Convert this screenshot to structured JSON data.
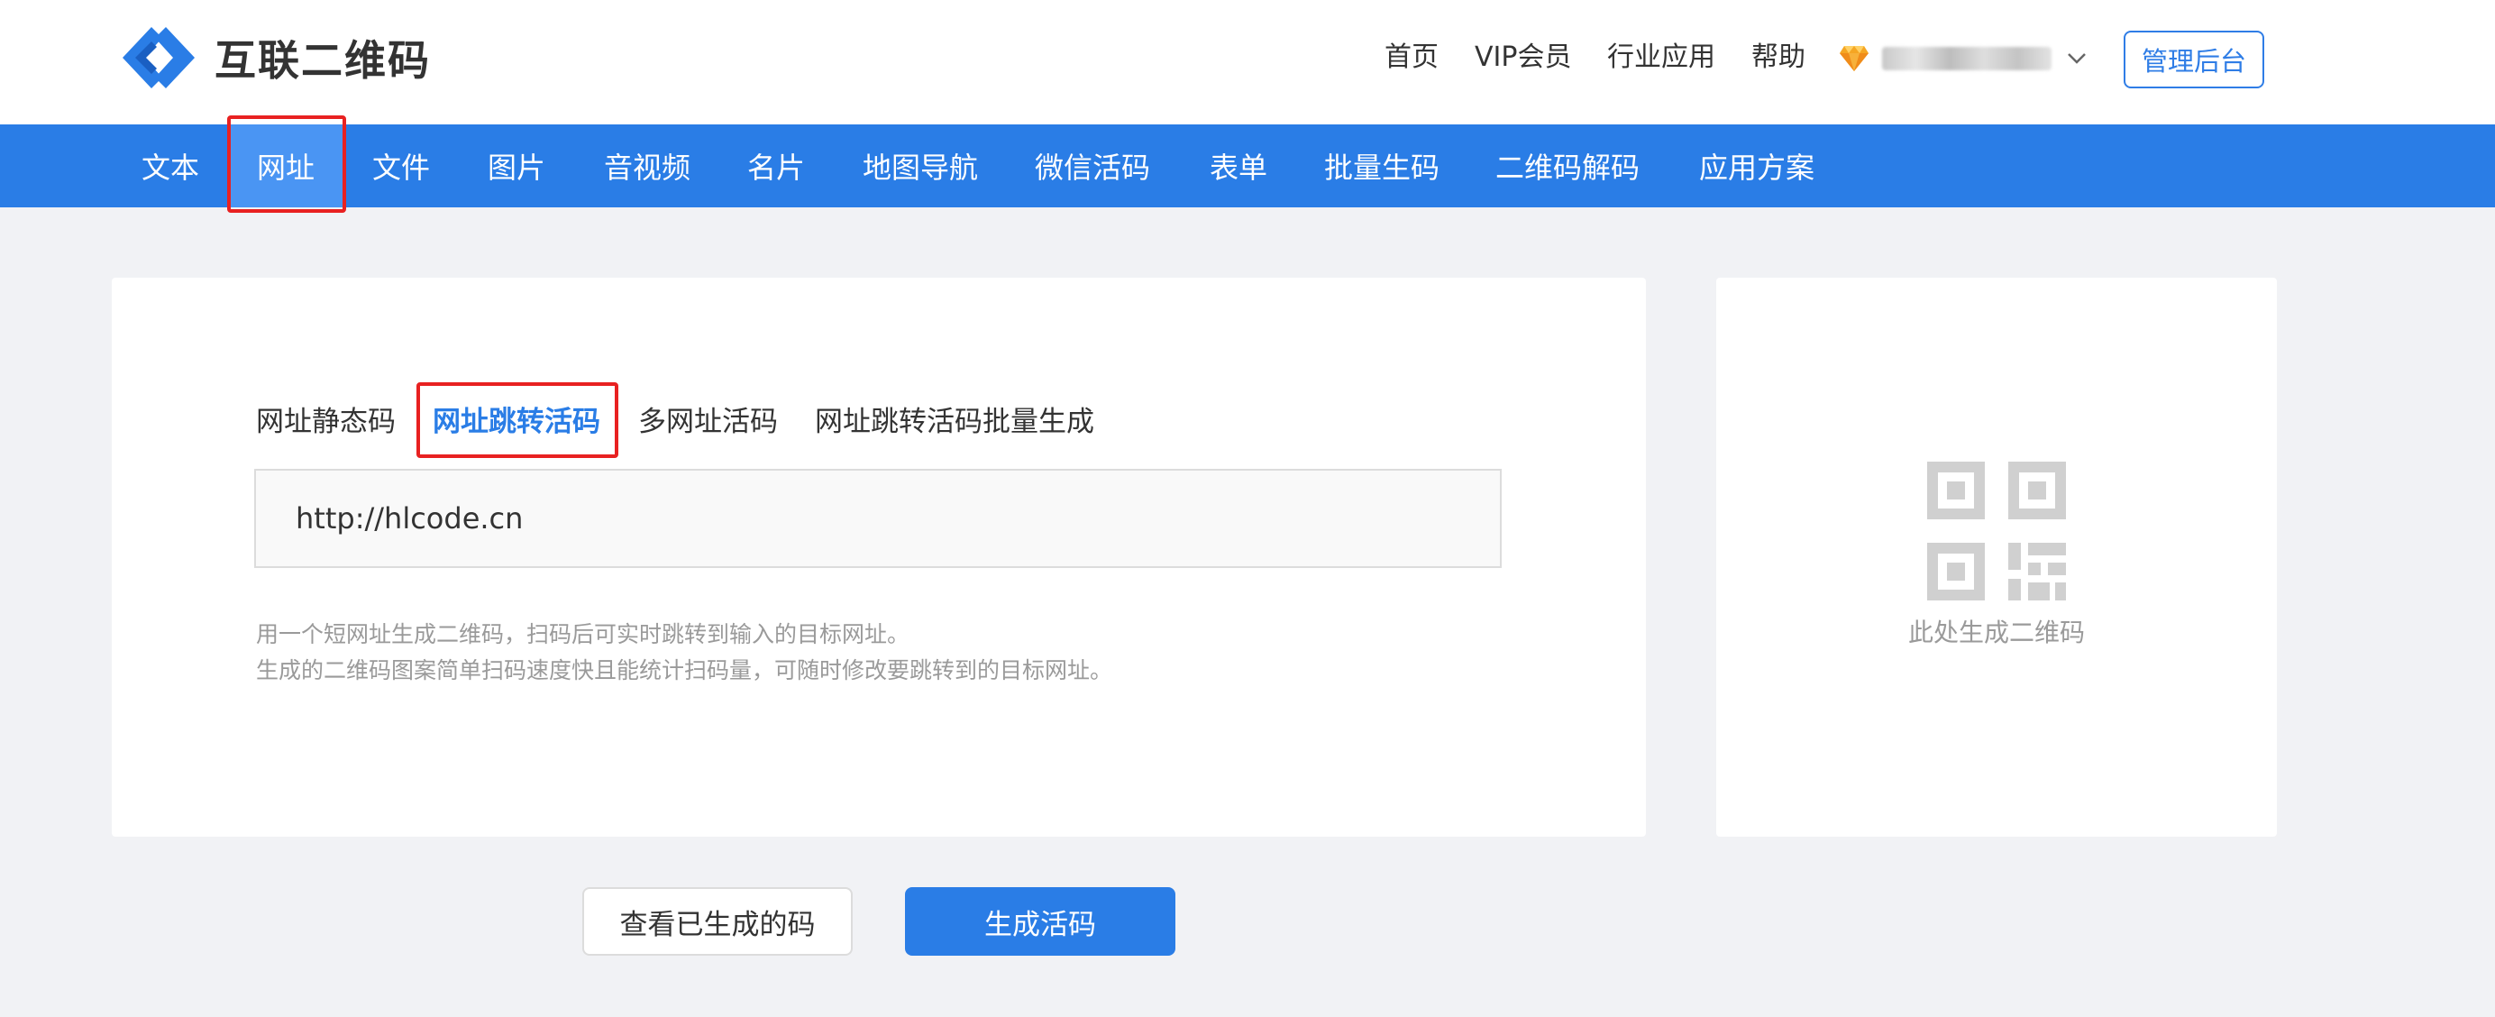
{
  "brand": {
    "name": "互联二维码",
    "primary_color": "#2a7de6",
    "highlight_color": "#e82121"
  },
  "top_nav": {
    "home": "首页",
    "vip": "VIP会员",
    "industry": "行业应用",
    "help": "帮助",
    "admin": "管理后台"
  },
  "categories": [
    {
      "label": "文本"
    },
    {
      "label": "网址",
      "active": true
    },
    {
      "label": "文件"
    },
    {
      "label": "图片"
    },
    {
      "label": "音视频"
    },
    {
      "label": "名片"
    },
    {
      "label": "地图导航"
    },
    {
      "label": "微信活码"
    },
    {
      "label": "表单"
    },
    {
      "label": "批量生码"
    },
    {
      "label": "二维码解码"
    },
    {
      "label": "应用方案"
    }
  ],
  "sub_tabs": [
    {
      "label": "网址静态码"
    },
    {
      "label": "网址跳转活码",
      "active": true
    },
    {
      "label": "多网址活码"
    },
    {
      "label": "网址跳转活码批量生成"
    }
  ],
  "url_input": {
    "value": "http://hlcode.cn"
  },
  "description": [
    "用一个短网址生成二维码，扫码后可实时跳转到输入的目标网址。",
    "生成的二维码图案简单扫码速度快且能统计扫码量，可随时修改要跳转到的目标网址。"
  ],
  "qr_preview": {
    "caption": "此处生成二维码"
  },
  "actions": {
    "view_generated": "查看已生成的码",
    "generate": "生成活码"
  }
}
